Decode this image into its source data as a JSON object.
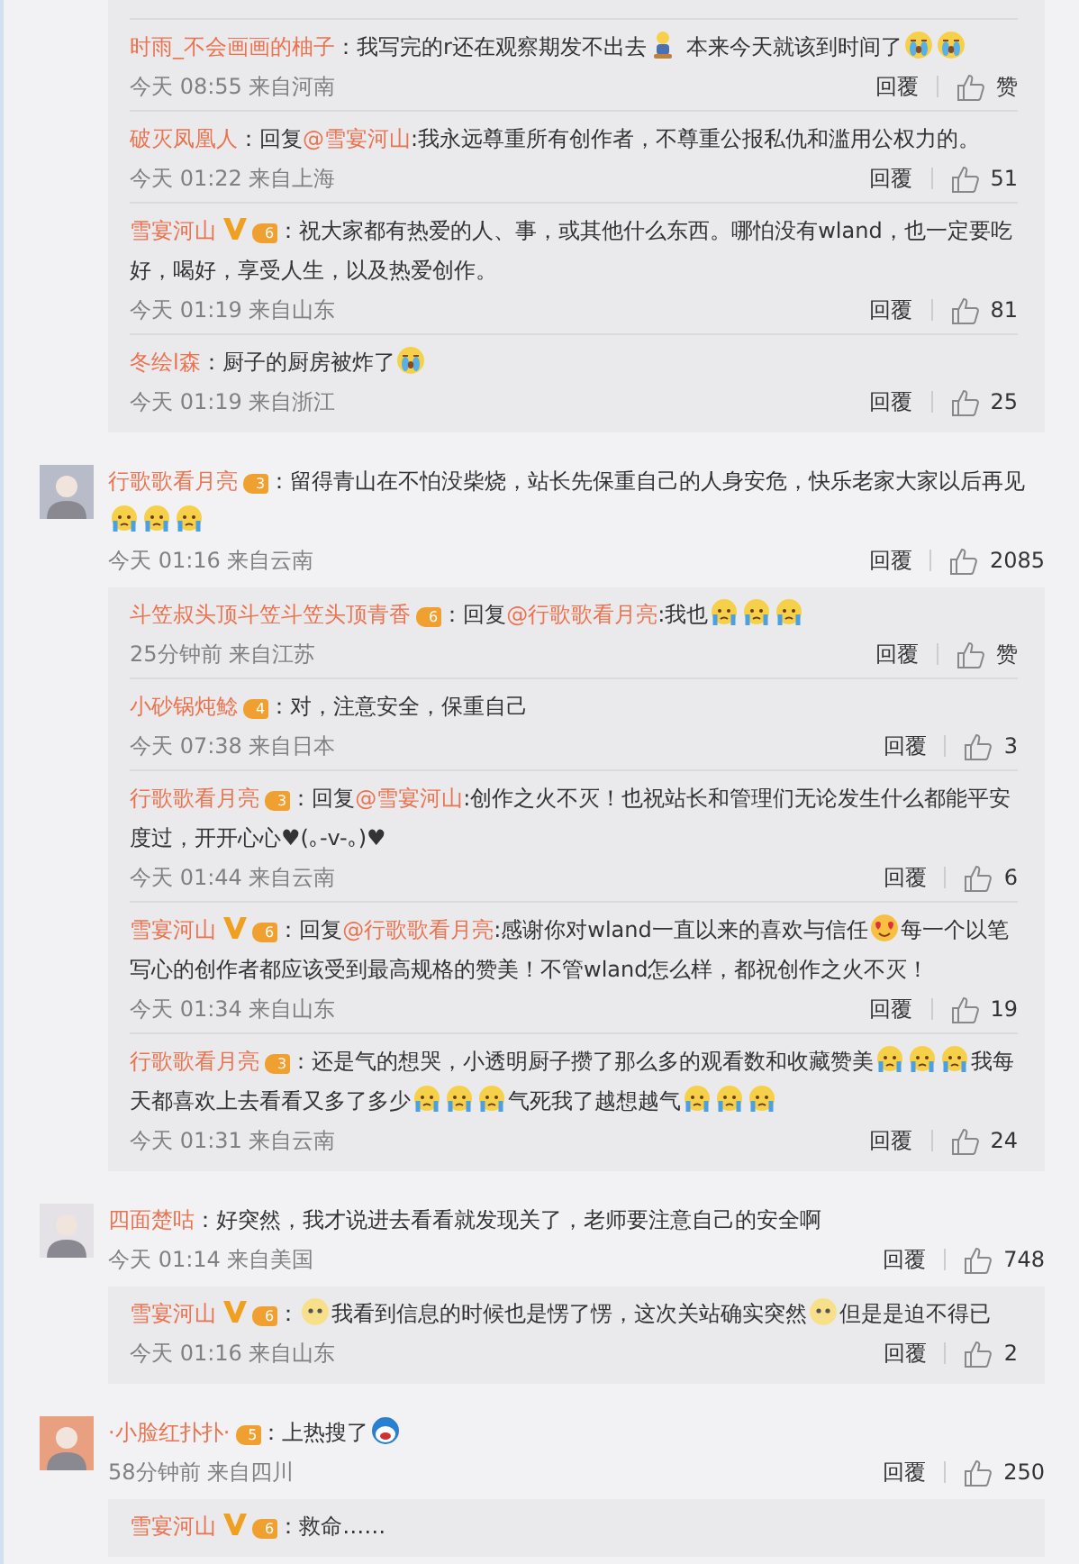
{
  "groups": [
    {
      "replies": [
        {
          "user": "时雨_不会画画的柚子",
          "verified": false,
          "parts": [
            {
              "kind": "text",
              "text": "：我写完的r还在观察期发不出去"
            },
            {
              "kind": "figure"
            },
            {
              "kind": "text",
              "text": " 本来今天就该到时间了"
            },
            {
              "kind": "cry"
            },
            {
              "kind": "cry"
            }
          ],
          "meta": "今天 08:55 来自河南",
          "reply": "回覆",
          "likes": "赞"
        },
        {
          "user": "破灭凤凰人",
          "verified": false,
          "parts": [
            {
              "kind": "text",
              "text": "：回复"
            },
            {
              "kind": "mention",
              "text": "@雪宴河山"
            },
            {
              "kind": "text",
              "text": ":我永远尊重所有创作者，不尊重公报私仇和滥用公权力的。"
            }
          ],
          "meta": "今天 01:22 来自上海",
          "reply": "回覆",
          "likes": "51"
        },
        {
          "user": "雪宴河山",
          "verified": true,
          "level": "6",
          "parts": [
            {
              "kind": "text",
              "text": "：祝大家都有热爱的人、事，或其他什么东西。哪怕没有wland，也一定要吃好，喝好，享受人生，以及热爱创作。"
            }
          ],
          "meta": "今天 01:19 来自山东",
          "reply": "回覆",
          "likes": "81"
        },
        {
          "user": "冬绘l森",
          "verified": false,
          "parts": [
            {
              "kind": "text",
              "text": "：厨子的厨房被炸了"
            },
            {
              "kind": "cry"
            }
          ],
          "meta": "今天 01:19 来自浙江",
          "reply": "回覆",
          "likes": "25"
        }
      ]
    },
    {
      "comment": {
        "user": "行歌歌看月亮",
        "verified": false,
        "level": "3",
        "parts": [
          {
            "kind": "text",
            "text": "：留得青山在不怕没柴烧，站长先保重自己的人身安危，快乐老家大家以后再见"
          },
          {
            "kind": "tearful"
          },
          {
            "kind": "tearful"
          },
          {
            "kind": "tearful"
          }
        ],
        "meta": "今天 01:16 来自云南",
        "reply": "回覆",
        "likes": "2085"
      },
      "replies": [
        {
          "user": "斗笠叔头顶斗笠斗笠头顶青香",
          "verified": false,
          "level": "6",
          "parts": [
            {
              "kind": "text",
              "text": "：回复"
            },
            {
              "kind": "mention",
              "text": "@行歌歌看月亮"
            },
            {
              "kind": "text",
              "text": ":我也"
            },
            {
              "kind": "tearful"
            },
            {
              "kind": "tearful"
            },
            {
              "kind": "tearful"
            }
          ],
          "meta": "25分钟前 来自江苏",
          "reply": "回覆",
          "likes": "赞"
        },
        {
          "user": "小砂锅炖鲶",
          "verified": false,
          "level": "4",
          "parts": [
            {
              "kind": "text",
              "text": "：对，注意安全，保重自己"
            }
          ],
          "meta": "今天 07:38 来自日本",
          "reply": "回覆",
          "likes": "3"
        },
        {
          "user": "行歌歌看月亮",
          "verified": false,
          "level": "3",
          "parts": [
            {
              "kind": "text",
              "text": "：回复"
            },
            {
              "kind": "mention",
              "text": "@雪宴河山"
            },
            {
              "kind": "text",
              "text": ":创作之火不灭！也祝站长和管理们无论发生什么都能平安度过，开开心心♥(｡-v-｡)♥"
            }
          ],
          "meta": "今天 01:44 来自云南",
          "reply": "回覆",
          "likes": "6"
        },
        {
          "user": "雪宴河山",
          "verified": true,
          "level": "6",
          "parts": [
            {
              "kind": "text",
              "text": "：回复"
            },
            {
              "kind": "mention",
              "text": "@行歌歌看月亮"
            },
            {
              "kind": "text",
              "text": ":感谢你对wland一直以来的喜欢与信任"
            },
            {
              "kind": "heart"
            },
            {
              "kind": "text",
              "text": "每一个以笔写心的创作者都应该受到最高规格的赞美！不管wland怎么样，都祝创作之火不灭！"
            }
          ],
          "meta": "今天 01:34 来自山东",
          "reply": "回覆",
          "likes": "19"
        },
        {
          "user": "行歌歌看月亮",
          "verified": false,
          "level": "3",
          "parts": [
            {
              "kind": "text",
              "text": "：还是气的想哭，小透明厨子攒了那么多的观看数和收藏赞美"
            },
            {
              "kind": "tearful"
            },
            {
              "kind": "tearful"
            },
            {
              "kind": "tearful"
            },
            {
              "kind": "text",
              "text": "我每天都喜欢上去看看又多了多少"
            },
            {
              "kind": "tearful"
            },
            {
              "kind": "tearful"
            },
            {
              "kind": "tearful"
            },
            {
              "kind": "text",
              "text": "气死我了越想越气"
            },
            {
              "kind": "tearful"
            },
            {
              "kind": "tearful"
            },
            {
              "kind": "tearful"
            }
          ],
          "meta": "今天 01:31 来自云南",
          "reply": "回覆",
          "likes": "24"
        }
      ]
    },
    {
      "comment": {
        "user": "四面楚咕",
        "verified": false,
        "parts": [
          {
            "kind": "text",
            "text": "：好突然，我才说进去看看就发现关了，老师要注意自己的安全啊"
          }
        ],
        "meta": "今天 01:14 来自美国",
        "reply": "回覆",
        "likes": "748"
      },
      "replies": [
        {
          "user": "雪宴河山",
          "verified": true,
          "level": "6",
          "parts": [
            {
              "kind": "text",
              "text": "："
            },
            {
              "kind": "stare"
            },
            {
              "kind": "text",
              "text": "我看到信息的时候也是愣了愣，这次关站确实突然"
            },
            {
              "kind": "stare"
            },
            {
              "kind": "text",
              "text": "但是是迫不得已"
            }
          ],
          "meta": "今天 01:16 来自山东",
          "reply": "回覆",
          "likes": "2"
        }
      ]
    },
    {
      "comment": {
        "user": "·小脸红扑扑·",
        "verified": false,
        "level": "5",
        "parts": [
          {
            "kind": "text",
            "text": "：上热搜了"
          },
          {
            "kind": "blue"
          }
        ],
        "meta": "58分钟前 来自四川",
        "reply": "回覆",
        "likes": "250"
      },
      "replies": [
        {
          "user": "雪宴河山",
          "verified": true,
          "level": "6",
          "parts": [
            {
              "kind": "text",
              "text": "：救命……"
            }
          ]
        }
      ]
    }
  ]
}
